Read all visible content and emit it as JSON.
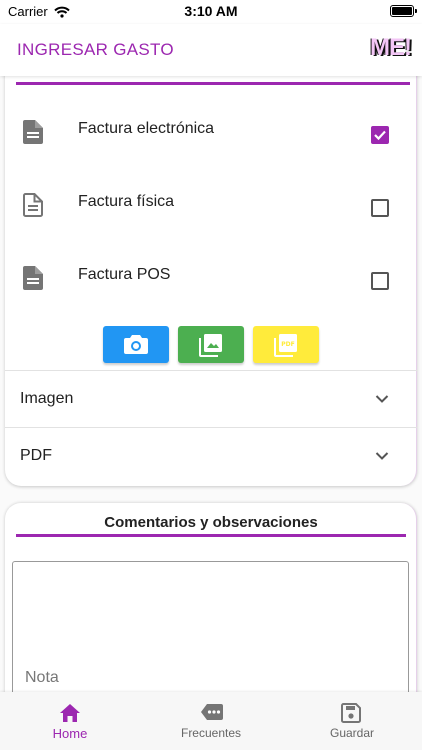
{
  "status_bar": {
    "carrier": "Carrier",
    "time": "3:10 AM"
  },
  "app_bar": {
    "title": "INGRESAR GASTO",
    "logo": "ME!"
  },
  "invoice_types": [
    {
      "label": "Factura electrónica",
      "checked": true
    },
    {
      "label": "Factura física",
      "checked": false
    },
    {
      "label": "Factura POS",
      "checked": false
    }
  ],
  "media_buttons": [
    {
      "name": "camera-button",
      "icon": "camera-icon",
      "color": "#2196f3"
    },
    {
      "name": "gallery-button",
      "icon": "gallery-icon",
      "color": "#4caf50"
    },
    {
      "name": "pdf-button",
      "icon": "pdf-icon",
      "color": "#ffeb3b"
    }
  ],
  "expanders": {
    "image_label": "Imagen",
    "pdf_label": "PDF"
  },
  "comments": {
    "title": "Comentarios y observaciones",
    "placeholder": "Nota"
  },
  "bottom_nav": {
    "home": "Home",
    "frequent": "Frecuentes",
    "save": "Guardar",
    "active": "home"
  },
  "colors": {
    "accent": "#9c27b0"
  }
}
